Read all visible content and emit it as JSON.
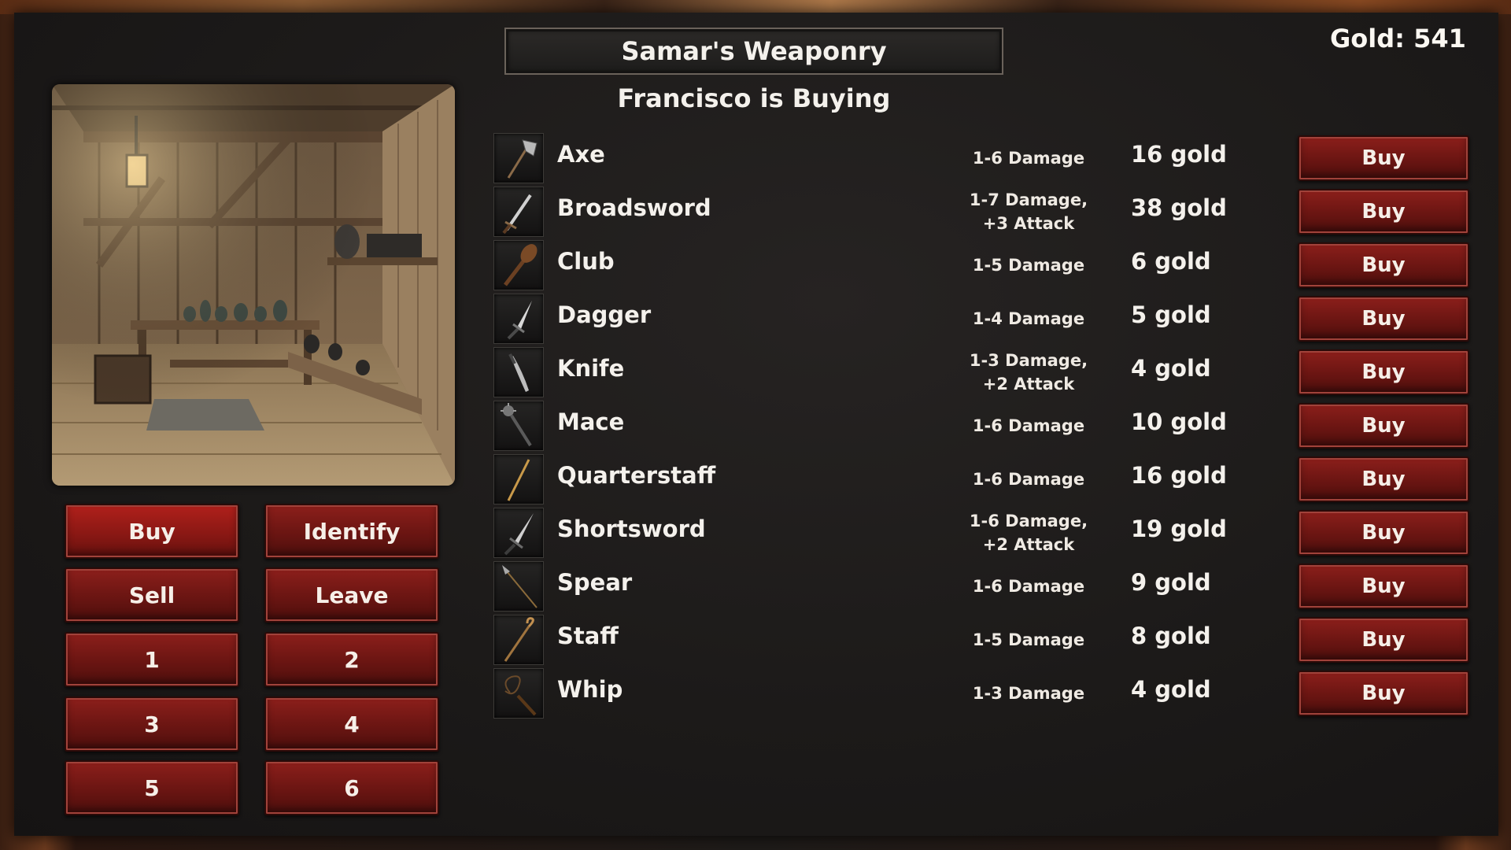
{
  "shop": {
    "title": "Samar's Weaponry",
    "subtitle": "Francisco is Buying",
    "gold": "Gold: 541"
  },
  "menu": {
    "buy": "Buy",
    "identify": "Identify",
    "sell": "Sell",
    "leave": "Leave",
    "slots": [
      "1",
      "2",
      "3",
      "4",
      "5",
      "6"
    ]
  },
  "items": [
    {
      "name": "Axe",
      "stats": "1-6 Damage",
      "price": "16 gold",
      "button": "Buy",
      "icon": "axe-icon"
    },
    {
      "name": "Broadsword",
      "stats": "1-7 Damage, +3 Attack",
      "price": "38 gold",
      "button": "Buy",
      "icon": "broadsword-icon"
    },
    {
      "name": "Club",
      "stats": "1-5 Damage",
      "price": "6 gold",
      "button": "Buy",
      "icon": "club-icon"
    },
    {
      "name": "Dagger",
      "stats": "1-4 Damage",
      "price": "5 gold",
      "button": "Buy",
      "icon": "dagger-icon"
    },
    {
      "name": "Knife",
      "stats": "1-3 Damage, +2 Attack",
      "price": "4 gold",
      "button": "Buy",
      "icon": "knife-icon"
    },
    {
      "name": "Mace",
      "stats": "1-6 Damage",
      "price": "10 gold",
      "button": "Buy",
      "icon": "mace-icon"
    },
    {
      "name": "Quarterstaff",
      "stats": "1-6 Damage",
      "price": "16 gold",
      "button": "Buy",
      "icon": "quarterstaff-icon"
    },
    {
      "name": "Shortsword",
      "stats": "1-6 Damage, +2 Attack",
      "price": "19 gold",
      "button": "Buy",
      "icon": "shortsword-icon"
    },
    {
      "name": "Spear",
      "stats": "1-6 Damage",
      "price": "9 gold",
      "button": "Buy",
      "icon": "spear-icon"
    },
    {
      "name": "Staff",
      "stats": "1-5 Damage",
      "price": "8 gold",
      "button": "Buy",
      "icon": "staff-icon"
    },
    {
      "name": "Whip",
      "stats": "1-3 Damage",
      "price": "4 gold",
      "button": "Buy",
      "icon": "whip-icon"
    }
  ]
}
